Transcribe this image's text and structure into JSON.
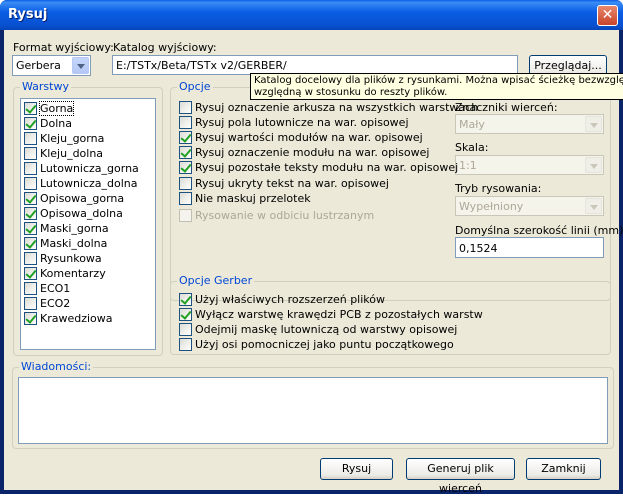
{
  "window": {
    "title": "Rysuj",
    "close_glyph": "✕"
  },
  "format": {
    "label": "Format wyjściowy:",
    "selected": "Gerbera"
  },
  "catalog": {
    "label": "Katalog wyjściowy:",
    "value": "E:/TSTx/Beta/TSTx v2/GERBER/",
    "browse_label": "Przeglądaj..."
  },
  "tooltip": {
    "line1": "Katalog docelowy dla plików z rysunkami. Można wpisać ścieżkę bezwzględną",
    "line2": "względną w stosunku do reszty plików."
  },
  "layers": {
    "title": "Warstwy",
    "items": [
      {
        "label": "Gorna",
        "checked": true
      },
      {
        "label": "Dolna",
        "checked": true
      },
      {
        "label": "Kleju_gorna",
        "checked": false
      },
      {
        "label": "Kleju_dolna",
        "checked": false
      },
      {
        "label": "Lutownicza_gorna",
        "checked": false
      },
      {
        "label": "Lutownicza_dolna",
        "checked": false
      },
      {
        "label": "Opisowa_gorna",
        "checked": true
      },
      {
        "label": "Opisowa_dolna",
        "checked": true
      },
      {
        "label": "Maski_gorna",
        "checked": true
      },
      {
        "label": "Maski_dolna",
        "checked": true
      },
      {
        "label": "Rysunkowa",
        "checked": false
      },
      {
        "label": "Komentarzy",
        "checked": true
      },
      {
        "label": "ECO1",
        "checked": false
      },
      {
        "label": "ECO2",
        "checked": false
      },
      {
        "label": "Krawedziowa",
        "checked": true
      }
    ]
  },
  "options": {
    "title": "Opcje",
    "items": [
      {
        "label": "Rysuj oznaczenie arkusza na wszystkich warstwach",
        "checked": false,
        "disabled": false
      },
      {
        "label": "Rysuj pola lutownicze na war. opisowej",
        "checked": false,
        "disabled": false
      },
      {
        "label": "Rysuj wartości modułów na war. opisowej",
        "checked": true,
        "disabled": false
      },
      {
        "label": "Rysuj oznaczenie modułu na war. opisowej",
        "checked": true,
        "disabled": false
      },
      {
        "label": "Rysuj pozostałe teksty modułu na war. opisowej",
        "checked": true,
        "disabled": false
      },
      {
        "label": "Rysuj ukryty tekst na war. opisowej",
        "checked": false,
        "disabled": false
      },
      {
        "label": "Nie maskuj przelotek",
        "checked": false,
        "disabled": false
      },
      {
        "label": "Rysowanie w odbiciu lustrzanym",
        "checked": false,
        "disabled": true
      }
    ],
    "drill_marks_label": "Znaczniki wierceń:",
    "drill_marks_value": "Mały",
    "scale_label": "Skala:",
    "scale_value": "1:1",
    "mode_label": "Tryb rysowania:",
    "mode_value": "Wypełniony",
    "line_width_label": "Domyślna szerokość linii (mm):",
    "line_width_value": "0,1524"
  },
  "gerber": {
    "title": "Opcje Gerber",
    "items": [
      {
        "label": "Użyj właściwych rozszerzeń plików",
        "checked": true
      },
      {
        "label": "Wyłącz warstwę krawędzi PCB z pozostałych warstw",
        "checked": true
      },
      {
        "label": "Odejmij maskę lutowniczą od warstwy opisowej",
        "checked": false
      },
      {
        "label": "Użyj osi pomocniczej jako puntu początkowego",
        "checked": false
      }
    ]
  },
  "messages": {
    "title": "Wiadomości:"
  },
  "buttons": {
    "plot": "Rysuj",
    "drill": "Generuj plik wierceń",
    "close": "Zamknij"
  }
}
